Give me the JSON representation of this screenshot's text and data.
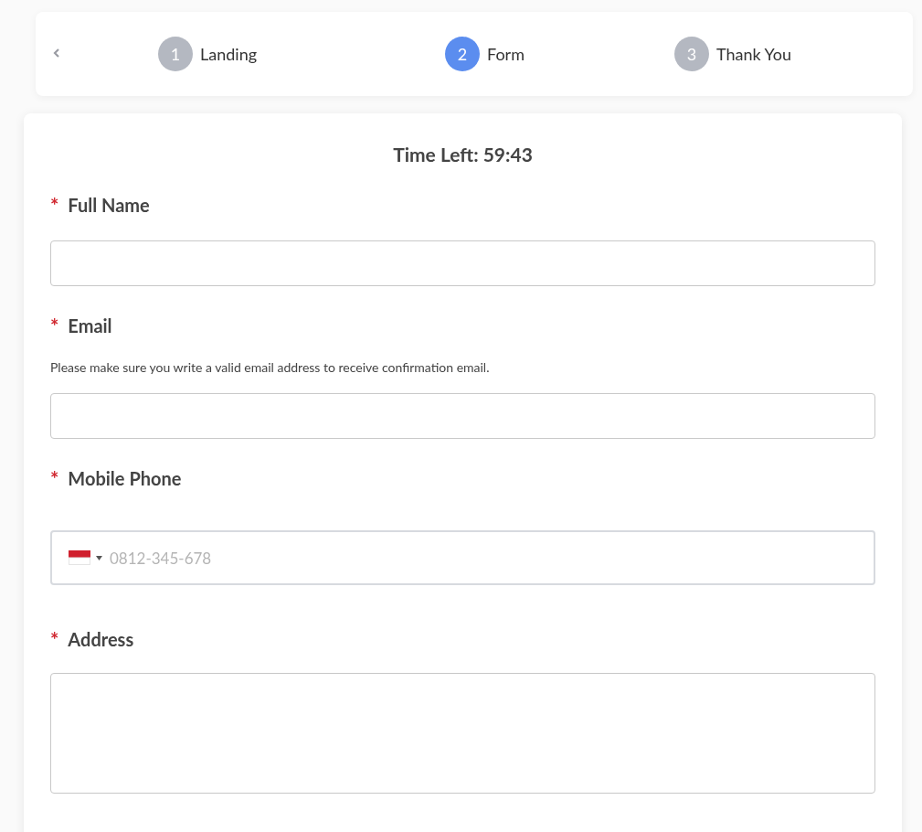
{
  "steps": [
    {
      "number": "1",
      "label": "Landing",
      "selected": false
    },
    {
      "number": "2",
      "label": "Form",
      "selected": true
    },
    {
      "number": "3",
      "label": "Thank You",
      "selected": false
    }
  ],
  "timer": "Time Left: 59:43",
  "fields": [
    {
      "kind": "text",
      "required_mark": "*",
      "label": "Full Name"
    },
    {
      "kind": "text",
      "required_mark": "*",
      "label": "Email",
      "hint": "Please make sure you write a valid email address to receive confirmation email."
    },
    {
      "kind": "phone",
      "required_mark": "*",
      "label": "Mobile Phone",
      "placeholder": "0812-345-678"
    },
    {
      "kind": "textarea",
      "required_mark": "*",
      "label": "Address"
    }
  ]
}
